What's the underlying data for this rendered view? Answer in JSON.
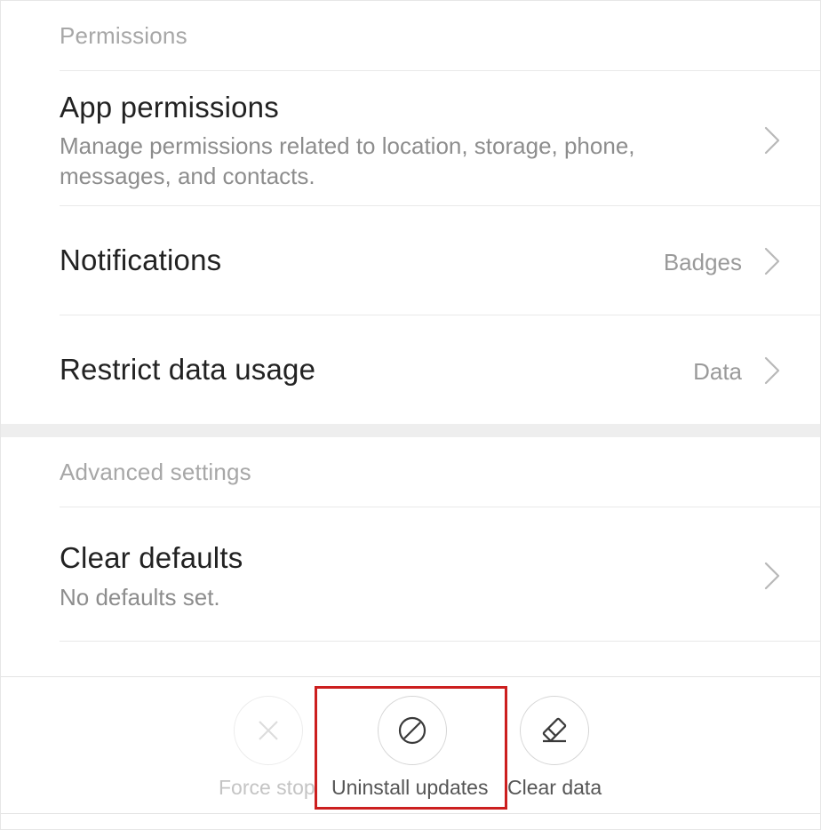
{
  "sections": {
    "permissions_header": "Permissions",
    "advanced_header": "Advanced settings"
  },
  "rows": {
    "app_permissions": {
      "title": "App permissions",
      "subtitle": "Manage permissions related to location, storage, phone, messages, and contacts."
    },
    "notifications": {
      "title": "Notifications",
      "value": "Badges"
    },
    "restrict_data": {
      "title": "Restrict data usage",
      "value": "Data"
    },
    "clear_defaults": {
      "title": "Clear defaults",
      "subtitle": "No defaults set."
    }
  },
  "actions": {
    "force_stop": {
      "label": "Force stop",
      "icon": "close-icon",
      "enabled": false
    },
    "uninstall_updates": {
      "label": "Uninstall updates",
      "icon": "block-icon",
      "enabled": true
    },
    "clear_data": {
      "label": "Clear data",
      "icon": "eraser-icon",
      "enabled": true
    }
  },
  "colors": {
    "highlight": "#cc1f1f",
    "title_text": "#222222",
    "secondary_text": "#8d8d8d",
    "header_text": "#a7a7a7"
  }
}
